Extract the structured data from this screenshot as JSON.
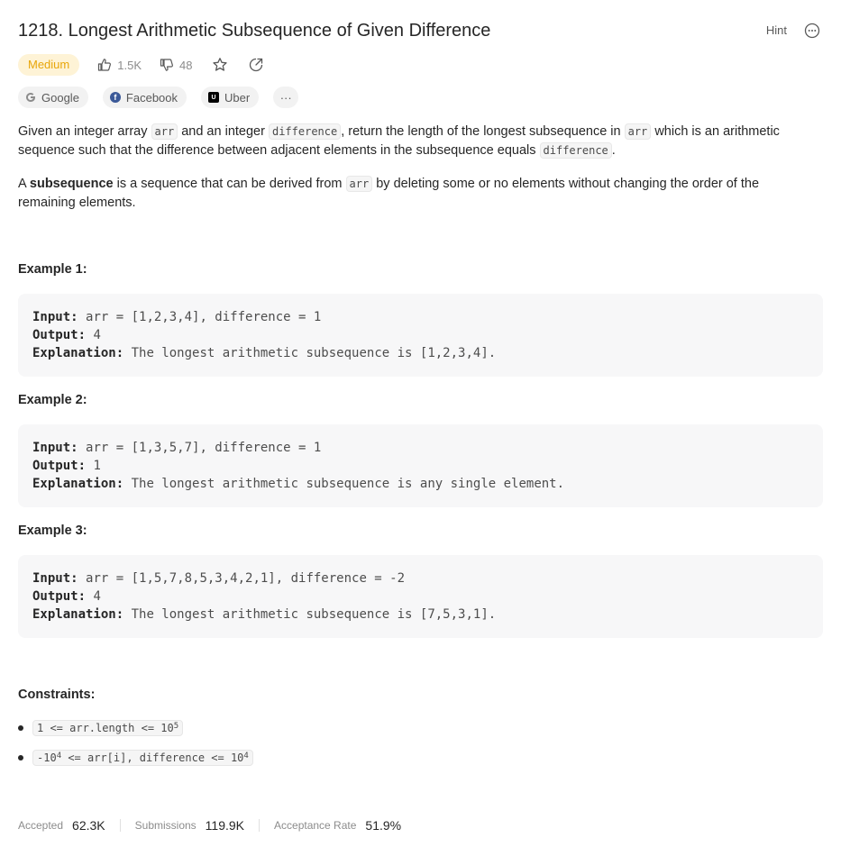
{
  "problem": {
    "title": "1218. Longest Arithmetic Subsequence of Given Difference",
    "hint_label": "Hint",
    "difficulty": "Medium",
    "likes": "1.5K",
    "dislikes": "48"
  },
  "companies": [
    {
      "name": "Google",
      "icon": "google-logo"
    },
    {
      "name": "Facebook",
      "icon": "facebook-logo"
    },
    {
      "name": "Uber",
      "icon": "uber-logo"
    }
  ],
  "companies_more": "···",
  "description": {
    "p1_a": "Given an integer array ",
    "p1_code1": "arr",
    "p1_b": " and an integer ",
    "p1_code2": "difference",
    "p1_c": ", return the length of the longest subsequence in ",
    "p1_code3": "arr",
    "p1_d": " which is an arithmetic sequence such that the difference between adjacent elements in the subsequence equals ",
    "p1_code4": "difference",
    "p1_e": ".",
    "p2_a": "A ",
    "p2_bold": "subsequence",
    "p2_b": " is a sequence that can be derived from ",
    "p2_code": "arr",
    "p2_c": " by deleting some or no elements without changing the order of the remaining elements."
  },
  "examples": [
    {
      "title": "Example 1:",
      "input_label": "Input:",
      "input": "arr = [1,2,3,4], difference = 1",
      "output_label": "Output:",
      "output": "4",
      "explanation_label": "Explanation:",
      "explanation": "The longest arithmetic subsequence is [1,2,3,4]."
    },
    {
      "title": "Example 2:",
      "input_label": "Input:",
      "input": "arr = [1,3,5,7], difference = 1",
      "output_label": "Output:",
      "output": "1",
      "explanation_label": "Explanation:",
      "explanation": "The longest arithmetic subsequence is any single element."
    },
    {
      "title": "Example 3:",
      "input_label": "Input:",
      "input": "arr = [1,5,7,8,5,3,4,2,1], difference = -2",
      "output_label": "Output:",
      "output": "4",
      "explanation_label": "Explanation:",
      "explanation": "The longest arithmetic subsequence is [7,5,3,1]."
    }
  ],
  "constraints": {
    "title": "Constraints:",
    "c1_text": "1 <= arr.length <= 10",
    "c1_sup": "5",
    "c2_pre": "-10",
    "c2_sup1": "4",
    "c2_mid": " <= arr[i], difference <= 10",
    "c2_sup2": "4"
  },
  "stats": {
    "accepted_label": "Accepted",
    "accepted_value": "62.3K",
    "submissions_label": "Submissions",
    "submissions_value": "119.9K",
    "rate_label": "Acceptance Rate",
    "rate_value": "51.9%"
  }
}
